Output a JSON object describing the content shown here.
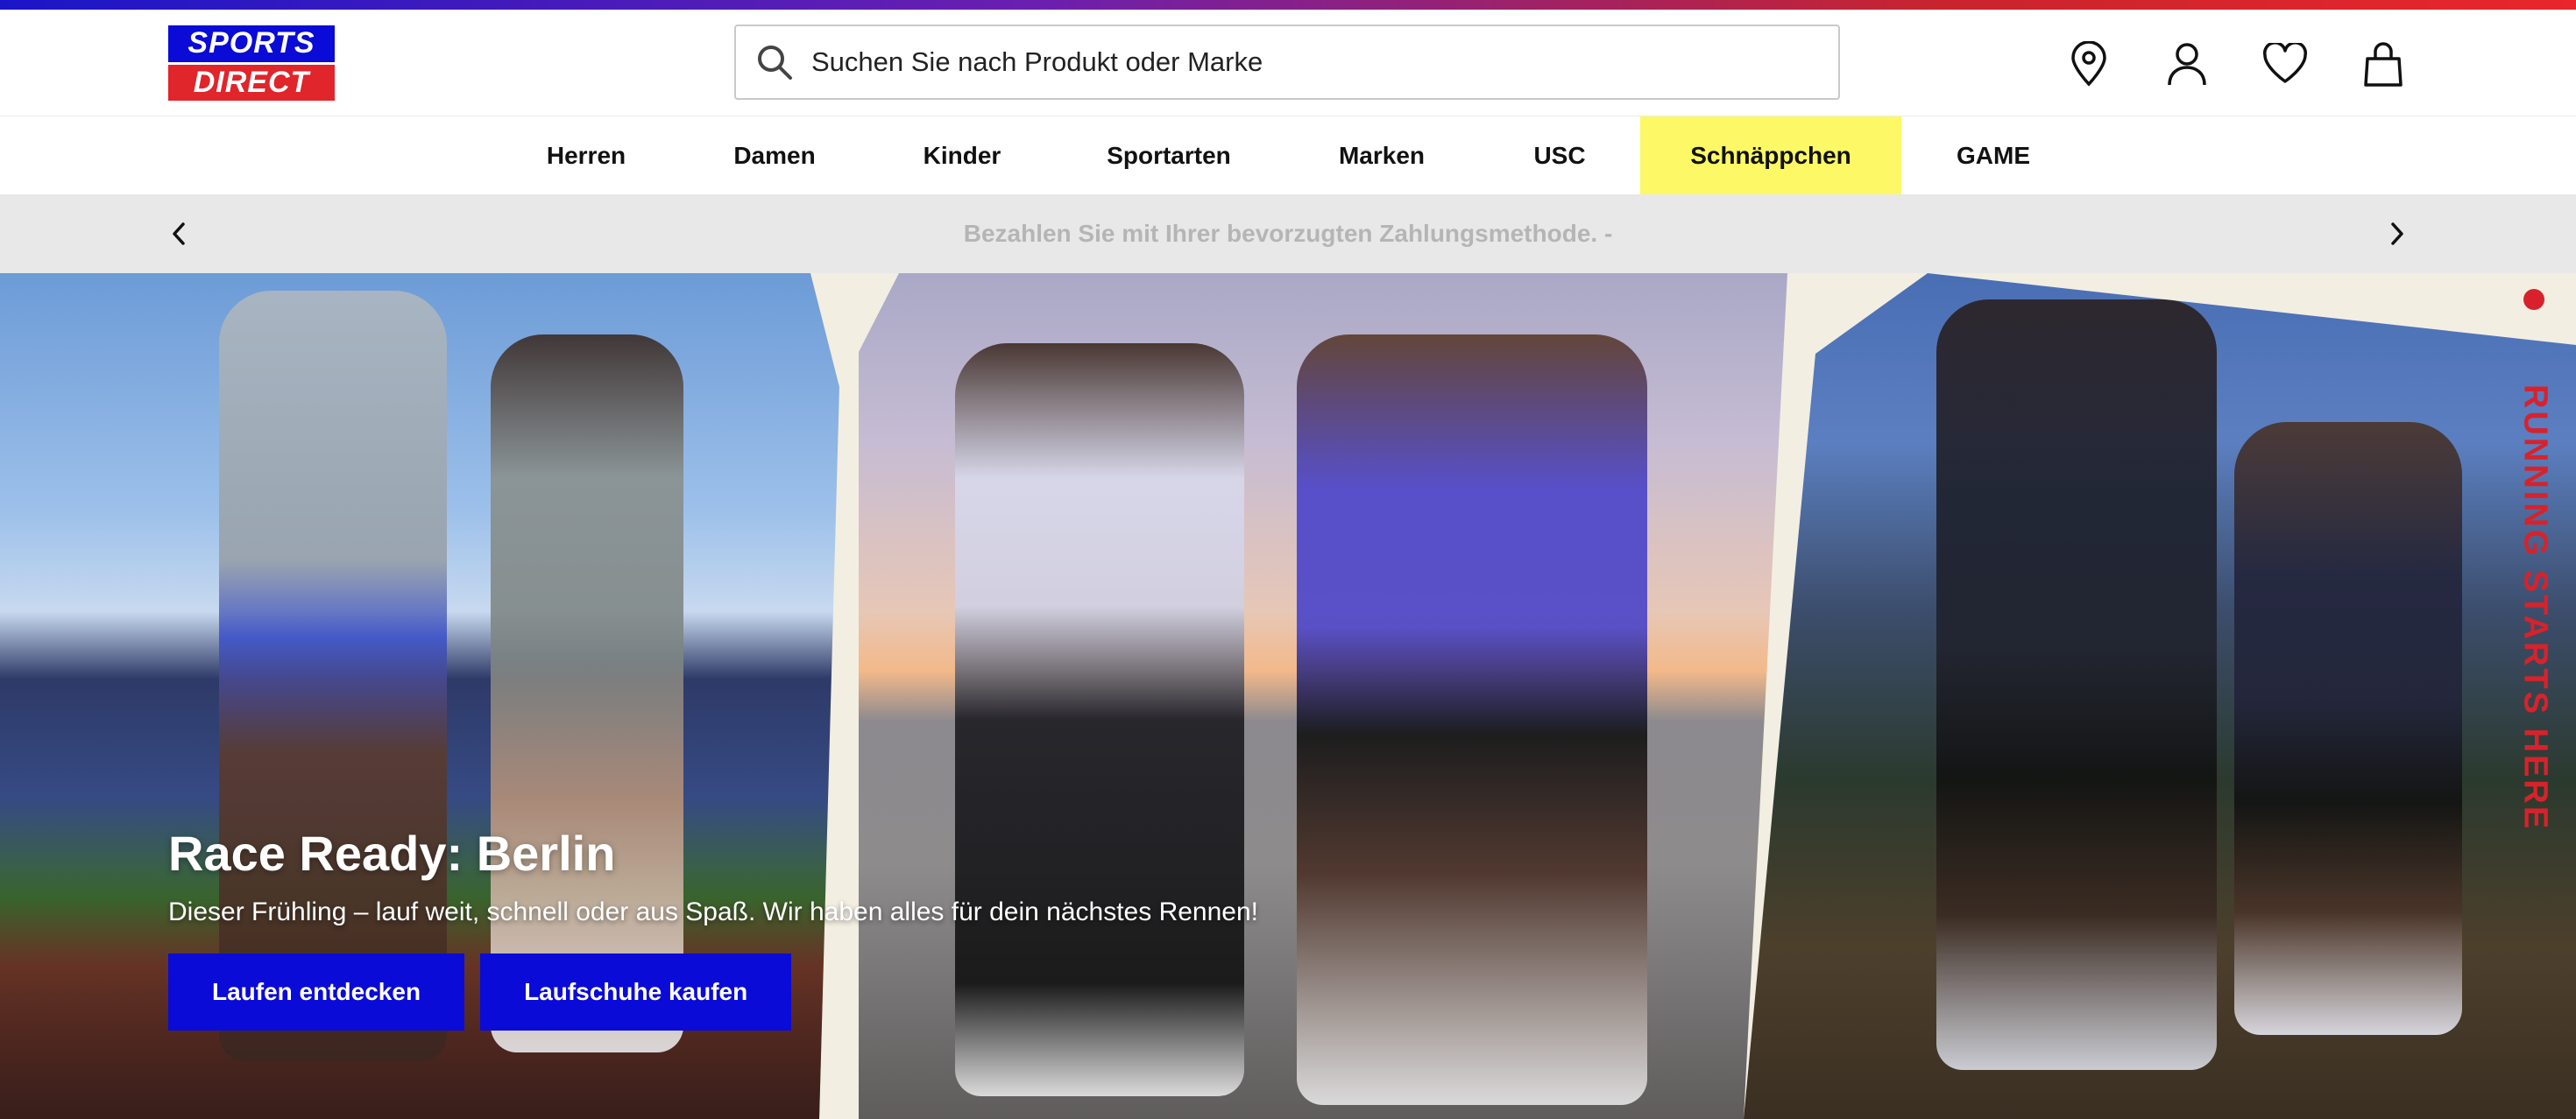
{
  "brand": {
    "logo_line1": "SPORTS",
    "logo_line2": "DIRECT",
    "colors": {
      "blue": "#0a0bd6",
      "red": "#e0252b",
      "highlight": "#fdf966"
    }
  },
  "search": {
    "placeholder": "Suchen Sie nach Produkt oder Marke",
    "icon": "search-icon"
  },
  "header_icons": [
    "store-locator-icon",
    "account-icon",
    "wishlist-icon",
    "bag-icon"
  ],
  "nav": {
    "items": [
      "Herren",
      "Damen",
      "Kinder",
      "Sportarten",
      "Marken",
      "USC",
      "Schnäppchen",
      "GAME"
    ],
    "highlighted": "Schnäppchen"
  },
  "promo": {
    "text": "Bezahlen Sie mit Ihrer bevorzugten Zahlungsmethode.  -"
  },
  "hero": {
    "title": "Race Ready: Berlin",
    "subtitle": "Dieser Frühling – lauf weit, schnell oder aus Spaß. Wir haben alles für dein nächstes Rennen!",
    "buttons": [
      "Laufen entdecken",
      "Laufschuhe kaufen"
    ],
    "side_slogan": "RUNNING STARTS HERE"
  }
}
